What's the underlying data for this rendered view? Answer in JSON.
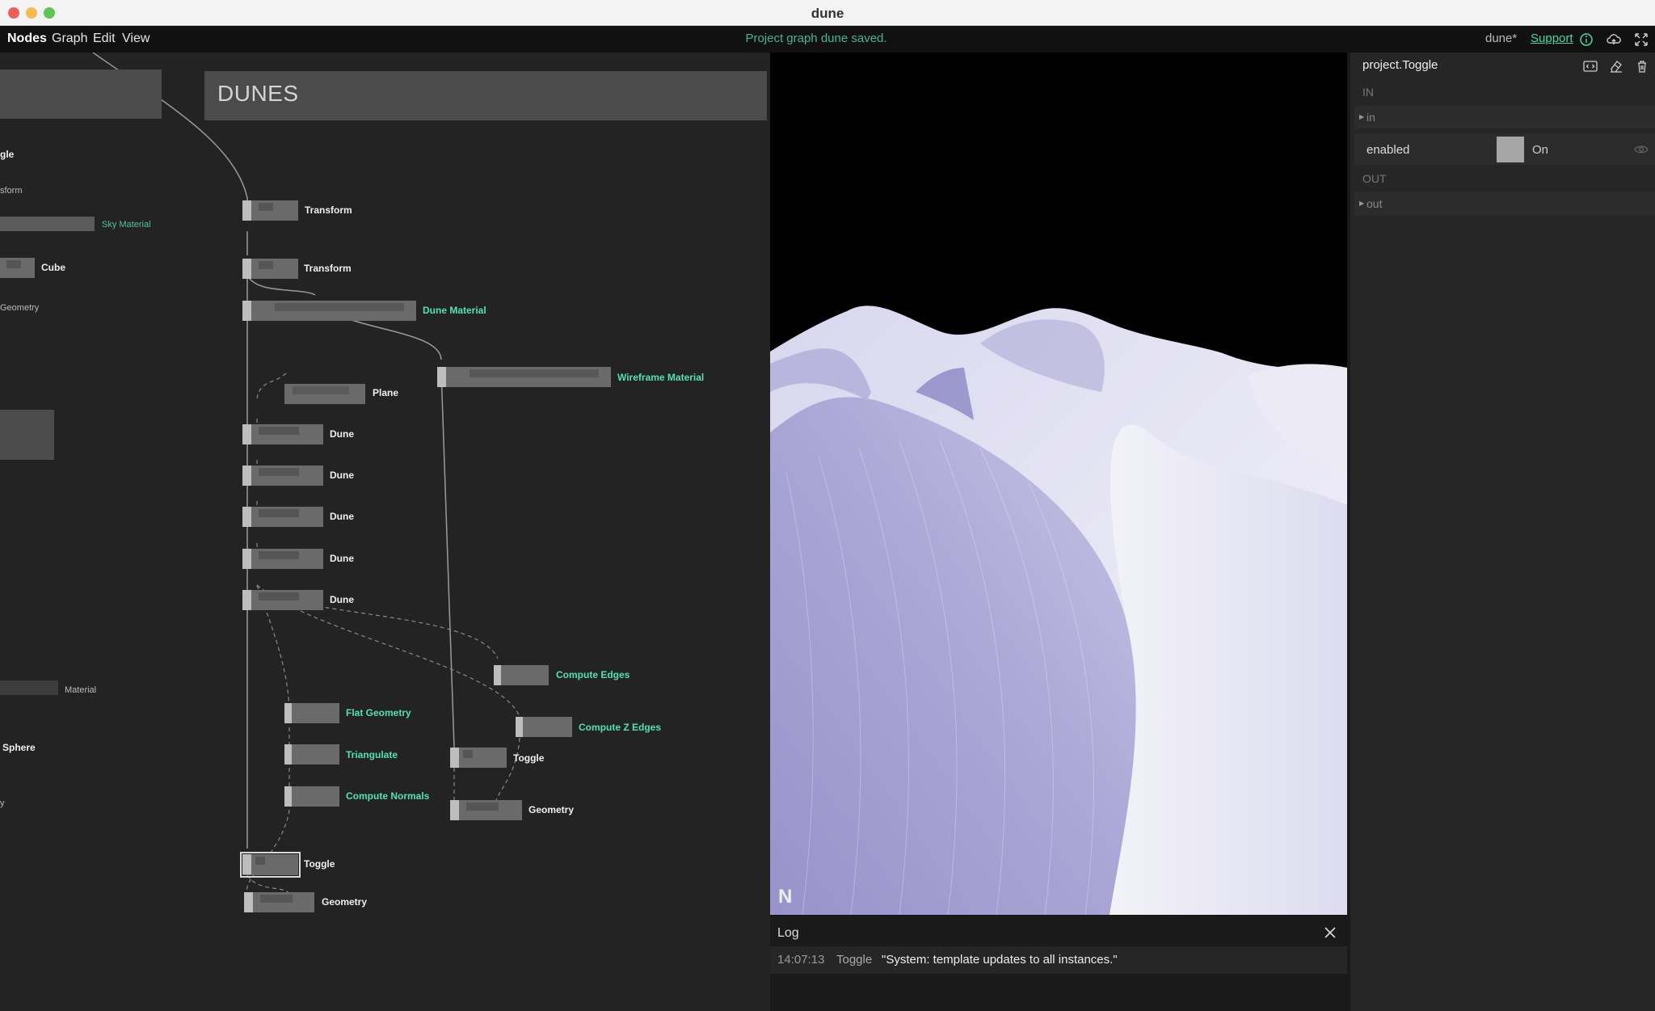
{
  "window": {
    "title": "dune"
  },
  "menu": {
    "items": [
      "Nodes",
      "Graph",
      "Edit",
      "View"
    ],
    "status": "Project graph dune saved.",
    "project_name": "dune*",
    "support_label": "Support"
  },
  "graph": {
    "comment_title": "DUNES",
    "left_labels": {
      "l1": "gle",
      "l2": "sform",
      "l3": "Sky Material",
      "l4": "Cube",
      "l5": "Geometry",
      "l6": "Material",
      "l7": "Sphere",
      "l8": "y"
    },
    "nodes": {
      "transform1": "Transform",
      "transform2": "Transform",
      "dune_material": "Dune Material",
      "wireframe_material": "Wireframe Material",
      "plane": "Plane",
      "dune1": "Dune",
      "dune2": "Dune",
      "dune3": "Dune",
      "dune4": "Dune",
      "dune5": "Dune",
      "compute_edges": "Compute Edges",
      "flat_geometry": "Flat Geometry",
      "compute_z_edges": "Compute Z Edges",
      "toggle_right": "Toggle",
      "triangulate": "Triangulate",
      "compute_normals": "Compute Normals",
      "geometry_right": "Geometry",
      "toggle_left": "Toggle",
      "geometry_left": "Geometry"
    }
  },
  "viewport": {
    "logo": "N",
    "sky_color": "#000000",
    "dune_colors": [
      "#9b97cc",
      "#c5c3e4",
      "#f1f1f7"
    ]
  },
  "log": {
    "title": "Log",
    "entries": [
      {
        "time": "14:07:13",
        "source": "Toggle",
        "message": "\"System: template updates to all instances.\""
      }
    ]
  },
  "inspector": {
    "title": "project.Toggle",
    "in_section": "IN",
    "in_port": "in",
    "param_label": "enabled",
    "param_value": "On",
    "out_section": "OUT",
    "out_port": "out"
  },
  "colors": {
    "accent": "#49d9a0",
    "status": "#48b58e",
    "node_label_green": "#52e3ad"
  }
}
